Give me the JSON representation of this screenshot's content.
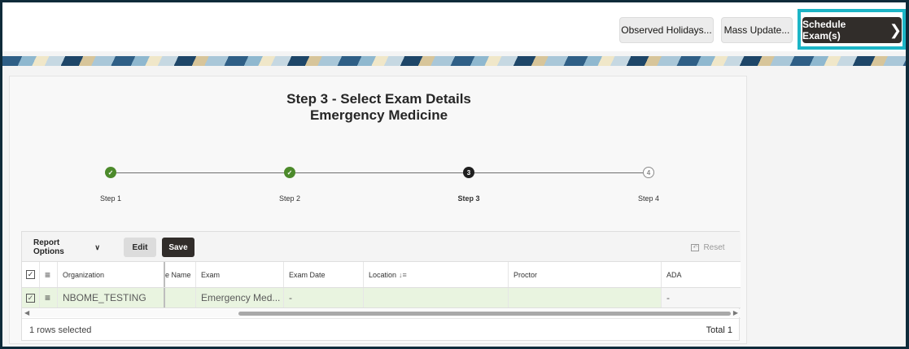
{
  "topbar": {
    "observed_holidays": "Observed Holidays...",
    "mass_update": "Mass Update...",
    "schedule_exams": "Schedule Exam(s)"
  },
  "page": {
    "title_line1": "Step 3 - Select Exam Details",
    "title_line2": "Emergency Medicine"
  },
  "steps": [
    {
      "label": "Step 1",
      "status": "complete"
    },
    {
      "label": "Step 2",
      "status": "complete"
    },
    {
      "label": "Step 3",
      "status": "current",
      "number": "3"
    },
    {
      "label": "Step 4",
      "status": "upcoming",
      "number": "4"
    }
  ],
  "grid": {
    "toolbar": {
      "report_options": "Report Options",
      "edit": "Edit",
      "save": "Save",
      "reset": "Reset"
    },
    "columns": [
      "Organization",
      "e Name",
      "Exam",
      "Exam Date",
      "Location",
      "Proctor",
      "ADA"
    ],
    "rows": [
      {
        "organization": "NBOME_TESTING",
        "name": "",
        "exam": "Emergency Med...",
        "exam_date": "-",
        "location": "",
        "proctor": "",
        "ada": "-"
      }
    ],
    "footer": {
      "selected": "1 rows selected",
      "total": "Total 1"
    }
  },
  "colors": {
    "accent_highlight": "#1cb5c6",
    "primary_button": "#312d2a",
    "step_complete": "#4c8a2b",
    "row_selected": "#e9f4e0"
  }
}
